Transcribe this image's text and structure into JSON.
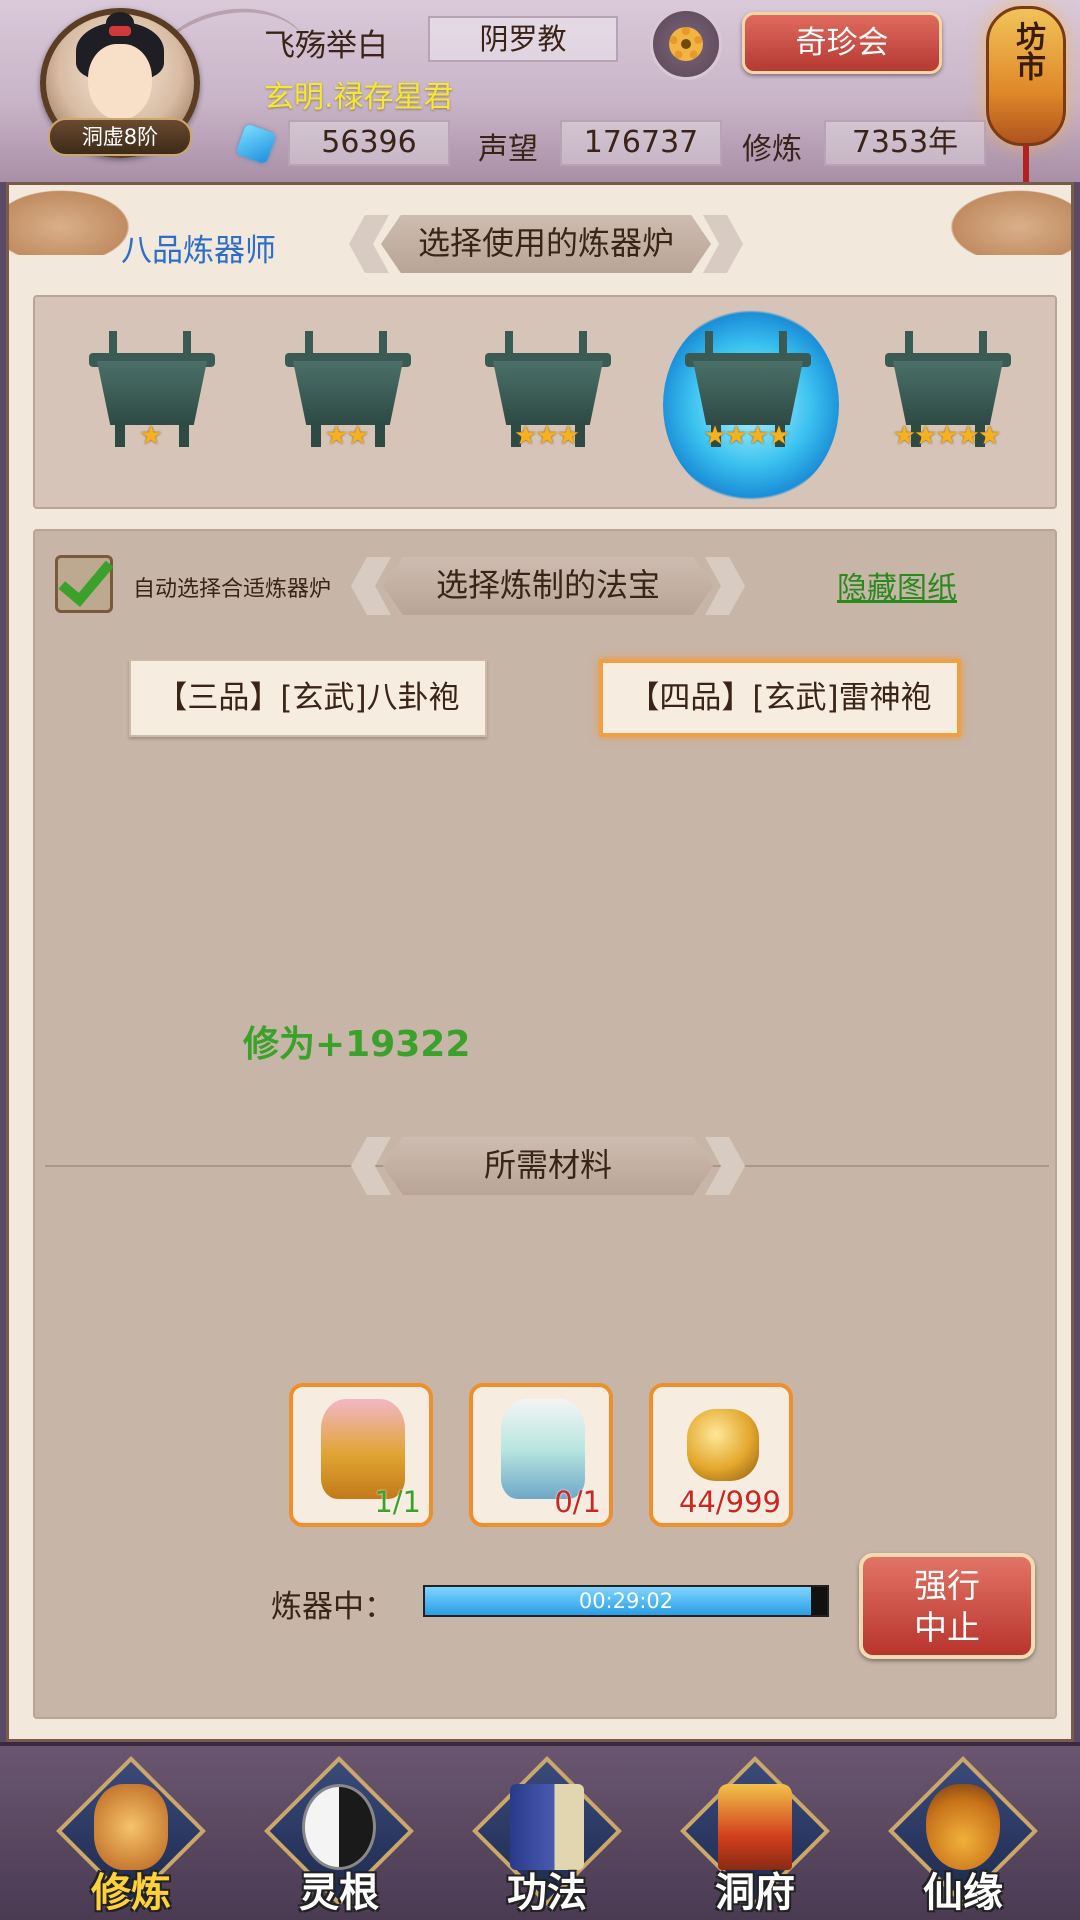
{
  "header": {
    "player_name": "飞殇举白",
    "sect": "阴罗教",
    "title": "玄明.禄存星君",
    "rank": "洞虚8阶",
    "treasure_button": "奇珍会",
    "market_label": "坊市",
    "gems": "56396",
    "reputation_label": "声望",
    "reputation": "176737",
    "cultivation_label": "修炼",
    "cultivation_years": "7353年"
  },
  "panel": {
    "master_level": "八品炼器师",
    "select_furnace_title": "选择使用的炼器炉",
    "furnaces": [
      {
        "stars": "★",
        "active": false
      },
      {
        "stars": "★★",
        "active": false
      },
      {
        "stars": "★★★",
        "active": false
      },
      {
        "stars": "★★★★",
        "active": true
      },
      {
        "stars": "★★★★★",
        "active": false
      }
    ],
    "auto_select_label": "自动选择合适炼器炉",
    "auto_select_checked": true,
    "select_treasure_title": "选择炼制的法宝",
    "hide_blueprints": "隐藏图纸",
    "recipes": [
      {
        "label": "【三品】[玄武]八卦袍",
        "selected": false
      },
      {
        "label": "【四品】[玄武]雷神袍",
        "selected": true
      }
    ],
    "cultivation_gain": "修为+19322",
    "materials_title": "所需材料",
    "materials": [
      {
        "icon": "golden-robe-icon",
        "count": "1/1"
      },
      {
        "icon": "white-robe-icon",
        "count": "0/1"
      },
      {
        "icon": "gold-ore-icon",
        "count": "44/999"
      }
    ],
    "refining_label": "炼器中：",
    "refining_time": "00:29:02",
    "refining_progress": 0.96,
    "abort_button_line1": "强行",
    "abort_button_line2": "中止"
  },
  "nav": [
    {
      "label": "修炼",
      "icon": "cultivation-icon",
      "active": true
    },
    {
      "label": "灵根",
      "icon": "spirit-root-icon",
      "active": false
    },
    {
      "label": "功法",
      "icon": "technique-book-icon",
      "active": false
    },
    {
      "label": "洞府",
      "icon": "cave-abode-icon",
      "active": false
    },
    {
      "label": "仙缘",
      "icon": "immortal-fate-icon",
      "active": false
    }
  ],
  "colors": {
    "accent_red": "#b8342c",
    "accent_orange": "#ef8f2c",
    "green_text": "#3aa22a",
    "blue_text": "#2d6fc6"
  }
}
